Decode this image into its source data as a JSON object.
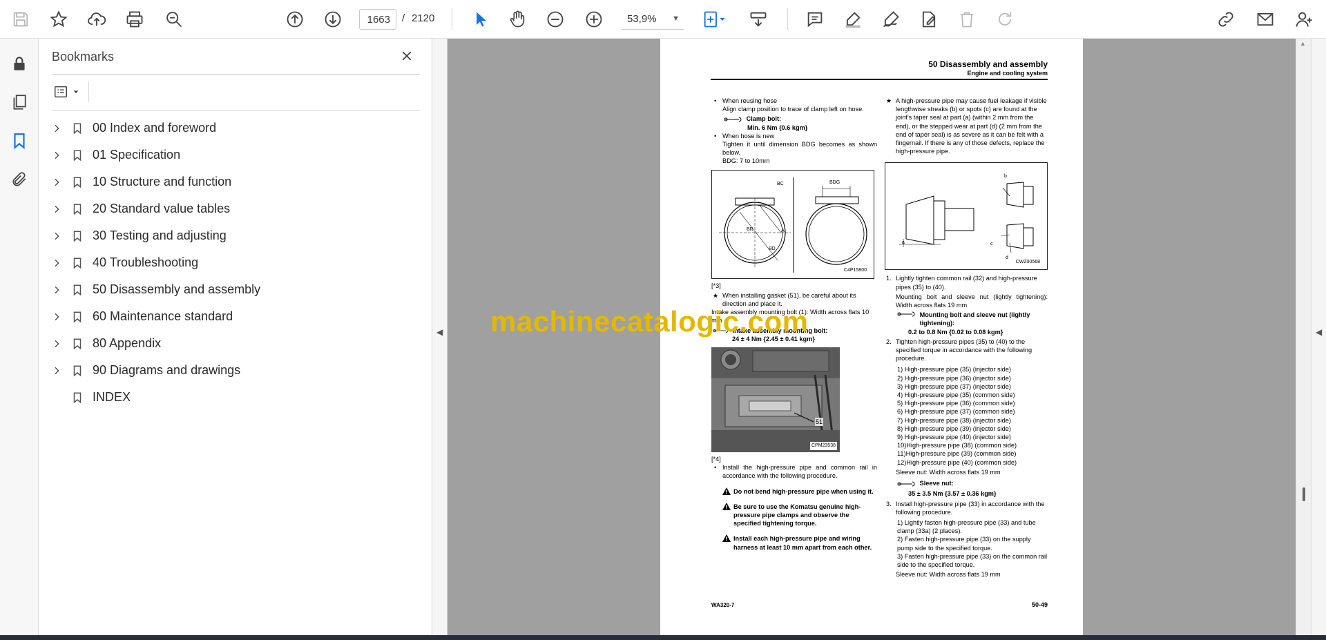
{
  "toolbar": {
    "page_current": "1663",
    "page_separator": "/",
    "page_total": "2120",
    "zoom": "53,9%"
  },
  "bookmarks": {
    "title": "Bookmarks",
    "items": [
      {
        "label": "00 Index and foreword",
        "expandable": true
      },
      {
        "label": "01 Specification",
        "expandable": true
      },
      {
        "label": "10 Structure and function",
        "expandable": true
      },
      {
        "label": "20 Standard value tables",
        "expandable": true
      },
      {
        "label": "30 Testing and adjusting",
        "expandable": true
      },
      {
        "label": "40 Troubleshooting",
        "expandable": true
      },
      {
        "label": "50 Disassembly and assembly",
        "expandable": true
      },
      {
        "label": "60 Maintenance standard",
        "expandable": true
      },
      {
        "label": "80 Appendix",
        "expandable": true
      },
      {
        "label": "90 Diagrams and drawings",
        "expandable": true
      },
      {
        "label": "INDEX",
        "expandable": false
      }
    ]
  },
  "document": {
    "header_title": "50 Disassembly and assembly",
    "header_subtitle": "Engine and cooling system",
    "left": {
      "b1_title": "When reusing hose",
      "b1_text": "Align clamp position to trace of clamp left on hose.",
      "t1_label": "Clamp bolt:",
      "t1_value": "Min. 6 Nm {0.6 kgm}",
      "b2_title": "When hose is new",
      "b2_text": "Tighten it until dimension BDG becomes as shown below.",
      "b2_dim": "BDG: 7 to 10mm",
      "fig1_id": "C4P15800",
      "fig1_labels": [
        "BC",
        "BDG",
        "BR",
        "BD",
        "A"
      ],
      "ref3": "[*3]",
      "s1_text": "When installing gasket (51), be careful about its direction and place it.",
      "s1_text2": "Intake assembly mounting bolt (1): Width across flats 10 mm",
      "t2_label": "Intake assembly mounting bolt:",
      "t2_value": "24 ± 4 Nm {2.45 ± 0.41 kgm}",
      "fig2_callout": "51",
      "fig2_id": "CPM23538",
      "ref4": "[*4]",
      "b3_text": "Install the high-pressure pipe and common rail in accordance with the following procedure.",
      "w1": "Do not bend high-pressure pipe when using it.",
      "w2": "Be sure to use the Komatsu genuine high-pressure pipe clamps and observe the specified tightening torque.",
      "w3": "Install each high-pressure pipe and wiring harness at least 10 mm apart from each other."
    },
    "right": {
      "s1_text": "A high-pressure pipe may cause fuel leakage if visible lengthwise streaks (b) or spots (c) are found at the joint's taper seal at part (a) (within 2 mm from the end), or the stepped wear at part (d) (2 mm from the end of taper seal) is as severe as it can be felt with a fingernail. If there is any of those defects, replace the high-pressure pipe.",
      "fig3_id": "CWZ00568",
      "fig3_labels": [
        "a",
        "b",
        "c",
        "d"
      ],
      "n1_num": "1.",
      "n1_text": "Lightly tighten common rail (32) and high-pressure pipes (35) to (40).",
      "n1_sub": "Mounting bolt and sleeve nut (lightly tightening): Width across flats 19 mm",
      "t1_label": "Mounting bolt and sleeve nut (lightly tightening):",
      "t1_value": "0.2 to 0.8 Nm {0.02 to 0.08 kgm}",
      "n2_num": "2.",
      "n2_text": "Tighten high-pressure pipes (35) to (40) to the specified torque in accordance with the following procedure.",
      "n2_steps": [
        "1) High-pressure pipe (35) (injector side)",
        "2) High-pressure pipe (36) (injector side)",
        "3) High-pressure pipe (37) (injector side)",
        "4) High-pressure pipe (35) (common side)",
        "5) High-pressure pipe (36) (common side)",
        "6) High-pressure pipe (37) (common side)",
        "7) High-pressure pipe (38) (injector side)",
        "8) High-pressure pipe (39) (injector side)",
        "9) High-pressure pipe (40) (injector side)",
        "10)High-pressure pipe (38) (common side)",
        "11)High-pressure pipe (39) (common side)",
        "12)High-pressure pipe (40) (common side)"
      ],
      "n2_after": "Sleeve nut: Width across flats 19 mm",
      "t2_label": "Sleeve nut:",
      "t2_value": "35 ± 3.5 Nm {3.57 ± 0.36 kgm}",
      "n3_num": "3.",
      "n3_text": "Install high-pressure pipe (33) in accordance with the following procedure.",
      "n3_steps": [
        "1) Lightly fasten high-pressure pipe (33) and tube clamp (33a) (2 places).",
        "2) Fasten high-pressure pipe (33) on the supply pump side to the specified torque.",
        "3) Fasten high-pressure pipe (33) on the common rail side to the specified torque."
      ],
      "n3_after": "Sleeve nut: Width across flats 19 mm"
    },
    "footer_left": "WA320-7",
    "footer_right": "50-49"
  },
  "watermark": "machinecatalogic.com",
  "colors": {
    "accent": "#1473e6",
    "watermark": "#e5b800",
    "doc_background": "#a0a0a0"
  }
}
